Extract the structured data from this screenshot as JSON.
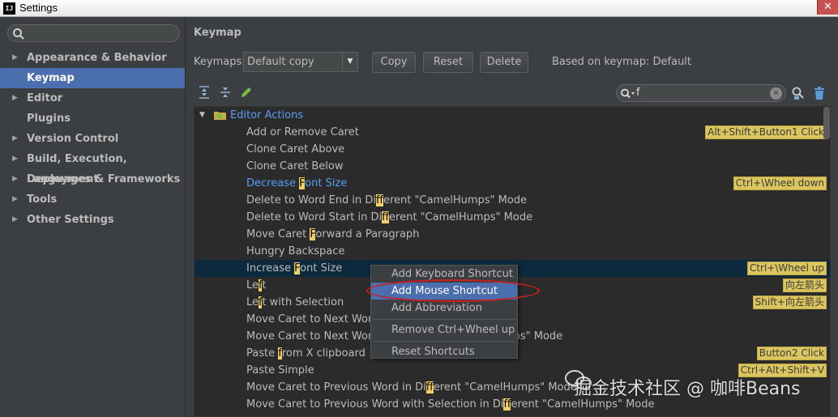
{
  "window": {
    "title": "Settings",
    "app_icon": "IJ",
    "close_label": "✕"
  },
  "sidebar": {
    "search_placeholder": "",
    "items": [
      {
        "label": "Appearance & Behavior",
        "expandable": true,
        "selected": false
      },
      {
        "label": "Keymap",
        "expandable": false,
        "selected": true
      },
      {
        "label": "Editor",
        "expandable": true,
        "selected": false
      },
      {
        "label": "Plugins",
        "expandable": false,
        "selected": false
      },
      {
        "label": "Version Control",
        "expandable": true,
        "selected": false
      },
      {
        "label": "Build, Execution, Deployment",
        "expandable": true,
        "selected": false
      },
      {
        "label": "Languages & Frameworks",
        "expandable": true,
        "selected": false
      },
      {
        "label": "Tools",
        "expandable": true,
        "selected": false
      },
      {
        "label": "Other Settings",
        "expandable": true,
        "selected": false
      }
    ]
  },
  "main": {
    "title": "Keymap",
    "keymaps_label": "Keymaps:",
    "keymap_value": "Default copy",
    "buttons": {
      "copy": "Copy",
      "reset": "Reset",
      "delete": "Delete"
    },
    "based_on": "Based on keymap: Default",
    "filter_value": "f"
  },
  "tree": {
    "group_label": "Editor Actions",
    "rows": [
      {
        "parts": [
          "Add or Remove Caret"
        ],
        "shortcut": "Alt+Shift+Button1 Click"
      },
      {
        "parts": [
          "Clone Caret Above"
        ],
        "shortcut": ""
      },
      {
        "parts": [
          "Clone Caret Below"
        ],
        "shortcut": ""
      },
      {
        "parts": [
          "Decrease ",
          "F",
          "ont Size"
        ],
        "shortcut": "Ctrl+\\Wheel down",
        "blue": true
      },
      {
        "parts": [
          "Delete to Word End in Di",
          "f",
          "ferent \"CamelHumps\" Mode"
        ],
        "shortcut": ""
      },
      {
        "parts": [
          "Delete to Word Start in Di",
          "f",
          "ferent \"CamelHumps\" Mode"
        ],
        "shortcut": ""
      },
      {
        "parts": [
          "Move Caret ",
          "F",
          "orward a Paragraph"
        ],
        "shortcut": ""
      },
      {
        "parts": [
          "Hungry Backspace"
        ],
        "shortcut": ""
      },
      {
        "parts": [
          "Increase ",
          "F",
          "ont Size"
        ],
        "shortcut": "Ctrl+\\Wheel up",
        "selected": true
      },
      {
        "parts": [
          "Le",
          "f",
          "t"
        ],
        "shortcut": "向左箭头"
      },
      {
        "parts": [
          "Le",
          "f",
          "t with Selection"
        ],
        "shortcut": "Shift+向左箭头"
      },
      {
        "parts": [
          "Move Caret to Next Word",
          "",
          "                              de"
        ],
        "shortcut": ""
      },
      {
        "parts": [
          "Move Caret to Next Word",
          "",
          "                              elHumps\" Mode"
        ],
        "shortcut": ""
      },
      {
        "parts": [
          "Paste ",
          "f",
          "rom X clipboard"
        ],
        "shortcut": "Button2 Click"
      },
      {
        "parts": [
          "Paste Simple"
        ],
        "shortcut": "Ctrl+Alt+Shift+V"
      },
      {
        "parts": [
          "Move Caret to Previous Word in Di",
          "f",
          "ferent \"CamelHumps\" Mode"
        ],
        "shortcut": ""
      },
      {
        "parts": [
          "Move Caret to Previous Word with Selection in Di",
          "f",
          "ferent \"CamelHumps\" Mode"
        ],
        "shortcut": ""
      }
    ]
  },
  "context_menu": {
    "items": [
      {
        "label": "Add Keyboard Shortcut",
        "hover": false
      },
      {
        "label": "Add Mouse Shortcut",
        "hover": true
      },
      {
        "label": "Add Abbreviation",
        "hover": false
      },
      {
        "label": "Remove Ctrl+Wheel up",
        "hover": false
      },
      {
        "label": "Reset Shortcuts",
        "hover": false
      }
    ]
  },
  "watermark": "掘金技术社区 @ 咖啡Beans",
  "colors": {
    "accent": "#4b6eaf",
    "highlight": "#f0d066",
    "shortcut_bg": "#dbc55f",
    "link": "#589df6",
    "annotation": "#cc1e1e"
  }
}
